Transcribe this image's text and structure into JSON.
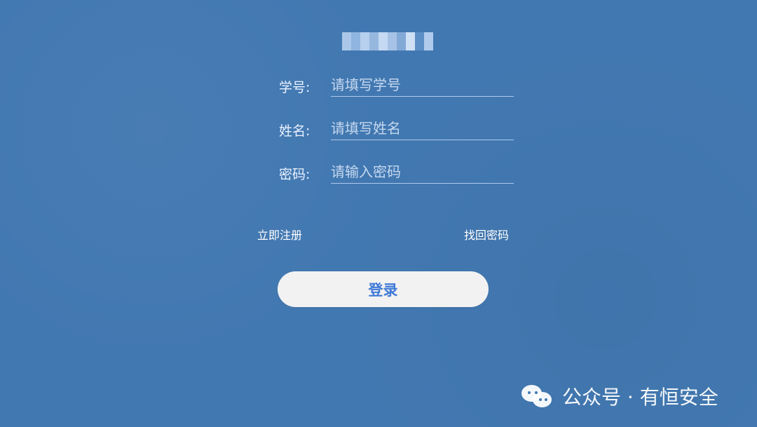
{
  "form": {
    "student_id": {
      "label": "学号:",
      "placeholder": "请填写学号"
    },
    "name": {
      "label": "姓名:",
      "placeholder": "请填写姓名"
    },
    "password": {
      "label": "密码:",
      "placeholder": "请输入密码"
    }
  },
  "links": {
    "register": "立即注册",
    "forgot_password": "找回密码"
  },
  "actions": {
    "login": "登录"
  },
  "watermark": {
    "text": "公众号 · 有恒安全",
    "icon": "wechat-icon"
  },
  "colors": {
    "background": "#4278b1",
    "button_background": "#f2f2f2",
    "button_text": "#3f79d6"
  }
}
